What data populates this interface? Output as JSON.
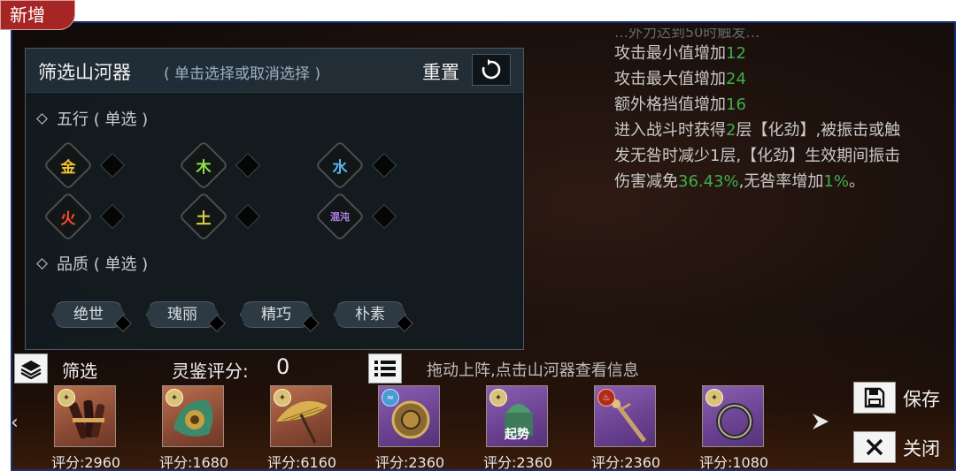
{
  "badge": "新增",
  "description": {
    "cut_line": "…外力达到50时触发…",
    "lines": [
      [
        {
          "t": "攻击最小值增加"
        },
        {
          "t": "12",
          "g": true
        }
      ],
      [
        {
          "t": "攻击最大值增加"
        },
        {
          "t": "24",
          "g": true
        }
      ],
      [
        {
          "t": "额外格挡值增加"
        },
        {
          "t": "16",
          "g": true
        }
      ],
      [
        {
          "t": "进入战斗时获得"
        },
        {
          "t": "2",
          "g": true
        },
        {
          "t": "层【化劲】,被振击或触"
        }
      ],
      [
        {
          "t": "发无咎时减少1层,【化劲】生效期间振击"
        }
      ],
      [
        {
          "t": "伤害减免"
        },
        {
          "t": "36.43%",
          "g": true
        },
        {
          "t": ",无咎率增加"
        },
        {
          "t": "1%",
          "g": true
        },
        {
          "t": "。"
        }
      ]
    ]
  },
  "panel": {
    "title": "筛选山河器",
    "subtitle": "( 单击选择或取消选择 )",
    "reset_label": "重置",
    "five_elements_label": "五行 ( 单选 )",
    "elements": [
      {
        "name": "金",
        "color": "#f2c230"
      },
      {
        "name": "木",
        "color": "#8ee04a"
      },
      {
        "name": "水",
        "color": "#58b8f0"
      },
      {
        "name": "火",
        "color": "#ff4a2a"
      },
      {
        "name": "土",
        "color": "#e0d040"
      },
      {
        "name": "混沌",
        "color": "#b080f0"
      }
    ],
    "quality_label": "品质 ( 单选 )",
    "qualities": [
      "绝世",
      "瑰丽",
      "精巧",
      "朴素"
    ]
  },
  "bar": {
    "filter_label": "筛选",
    "score_label": "灵鉴评分:",
    "score_value": "0",
    "hint": "拖动上阵,点击山河器查看信息"
  },
  "items": [
    {
      "score": "评分:2960",
      "bg": "brown",
      "corner": "gold",
      "tag": ""
    },
    {
      "score": "评分:1680",
      "bg": "brown",
      "corner": "gold",
      "tag": ""
    },
    {
      "score": "评分:6160",
      "bg": "brown",
      "corner": "gold",
      "tag": ""
    },
    {
      "score": "评分:2360",
      "bg": "purple",
      "corner": "blue",
      "tag": ""
    },
    {
      "score": "评分:2360",
      "bg": "purple",
      "corner": "gold",
      "tag": "起势"
    },
    {
      "score": "评分:2360",
      "bg": "purple",
      "corner": "red",
      "tag": ""
    },
    {
      "score": "评分:1080",
      "bg": "purple",
      "corner": "gold",
      "tag": ""
    }
  ],
  "actions": {
    "save": "保存",
    "close": "关闭"
  }
}
